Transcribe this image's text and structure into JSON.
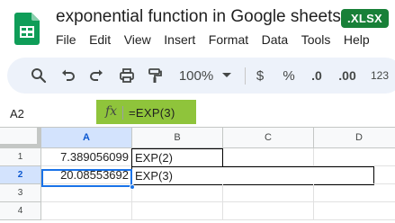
{
  "app": {
    "icon": "google-sheets-icon",
    "doc_title": "exponential function in Google sheets",
    "file_ext": ".XLSX",
    "brand_color": "#0f9d58"
  },
  "menu": [
    "File",
    "Edit",
    "View",
    "Insert",
    "Format",
    "Data",
    "Tools",
    "Help"
  ],
  "toolbar": {
    "icons": [
      "search-icon",
      "undo-icon",
      "redo-icon",
      "print-icon",
      "paint-format-icon"
    ],
    "zoom": "100%",
    "currency": "$",
    "percent": "%",
    "decrease_decimal": ".0",
    "increase_decimal": ".00",
    "number_format": "123"
  },
  "formula_bar": {
    "name_box": "A2",
    "fx": "fx",
    "formula": "=EXP(3)"
  },
  "grid": {
    "columns": [
      "A",
      "B",
      "C",
      "D"
    ],
    "rows": [
      "1",
      "2",
      "3",
      "4"
    ],
    "cells": {
      "A1": "7.389056099",
      "B1": "EXP(2)",
      "A2": "20.08553692",
      "B2": "EXP(3)"
    },
    "active_cell": "A2",
    "selection_color": "#1a73e8"
  }
}
